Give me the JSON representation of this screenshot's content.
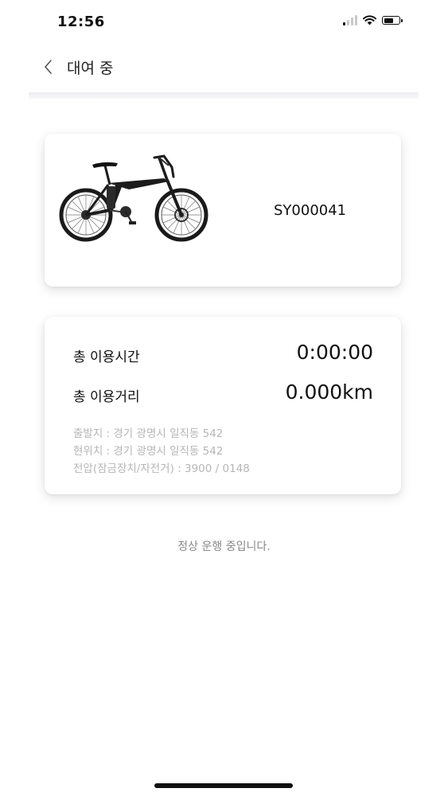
{
  "status_bar": {
    "time": "12:56",
    "icons": [
      "cellular-signal-icon",
      "wifi-icon",
      "battery-icon"
    ]
  },
  "header": {
    "back_icon": "chevron-left-icon",
    "title": "대여 중"
  },
  "bike": {
    "image": "electric-folding-bike",
    "id": "SY000041"
  },
  "usage": {
    "total_time_label": "총 이용시간",
    "total_time_value": "0:00:00",
    "total_distance_label": "총 이용거리",
    "total_distance_value": "0.000km",
    "info_lines": [
      "출발지 : 경기 광명시 일직동 542",
      "현위치 : 경기 광명시 일직동 542",
      "전압(잠금장치/자전거) : 3900 / 0148"
    ]
  },
  "status_message": "정상 운행 중입니다.",
  "colors": {
    "background": "#ffffff",
    "text_primary": "#111111",
    "text_muted": "#b6b6b6",
    "status_text": "#888888"
  }
}
